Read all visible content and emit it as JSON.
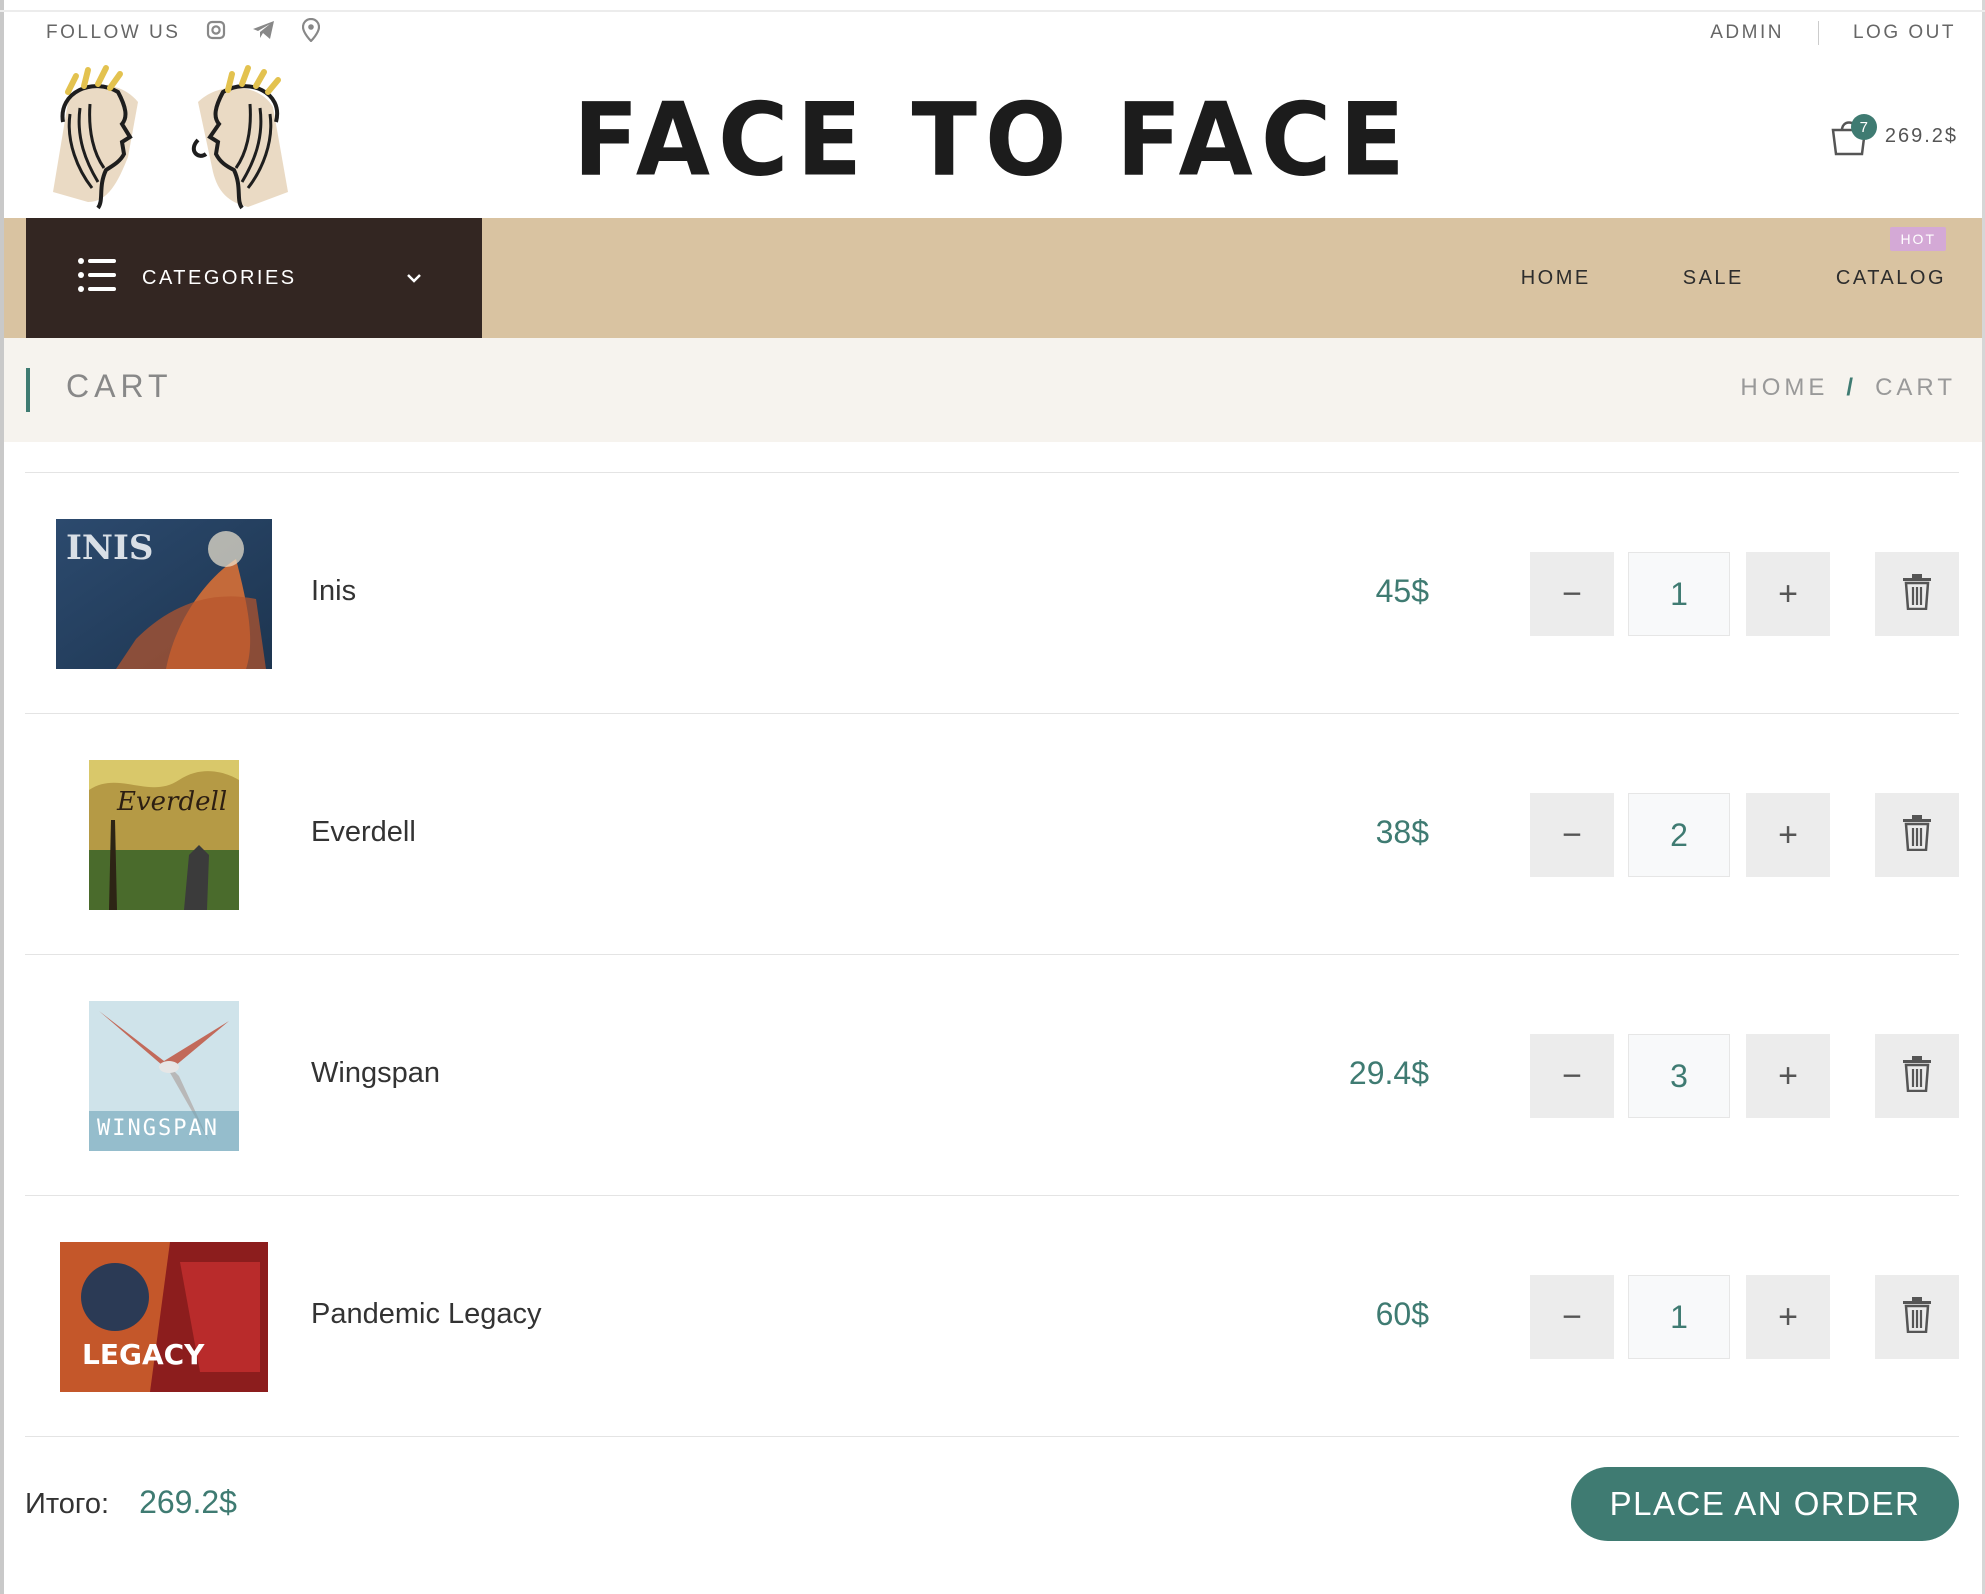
{
  "topbar": {
    "follow_label": "FOLLOW US",
    "social_icons": [
      "instagram-icon",
      "telegram-icon",
      "location-pin-icon"
    ],
    "admin_label": "ADMIN",
    "logout_label": "LOG OUT"
  },
  "header": {
    "brand": "FACE TO FACE",
    "cart_count": "7",
    "cart_total": "269.2$"
  },
  "nav": {
    "categories_label": "CATEGORIES",
    "menu": [
      {
        "label": "HOME"
      },
      {
        "label": "SALE"
      },
      {
        "label": "CATALOG",
        "badge": "HOT"
      }
    ]
  },
  "page": {
    "title": "CART",
    "breadcrumb": [
      "HOME",
      "CART"
    ]
  },
  "cart": {
    "items": [
      {
        "name": "Inis",
        "price": "45$",
        "qty": "1",
        "thumb_text": "INIS"
      },
      {
        "name": "Everdell",
        "price": "38$",
        "qty": "2",
        "thumb_text": "Everdell"
      },
      {
        "name": "Wingspan",
        "price": "29.4$",
        "qty": "3",
        "thumb_text": "WINGSPAN"
      },
      {
        "name": "Pandemic Legacy",
        "price": "60$",
        "qty": "1",
        "thumb_text": "LEGACY"
      }
    ],
    "total_label": "Итого:",
    "total_value": "269.2$",
    "order_label": "PLACE AN ORDER"
  },
  "colors": {
    "accent": "#3f7b72",
    "nav_bg": "#d9c3a1",
    "categories_bg": "#332622",
    "hot_badge": "#d4a9d6"
  }
}
